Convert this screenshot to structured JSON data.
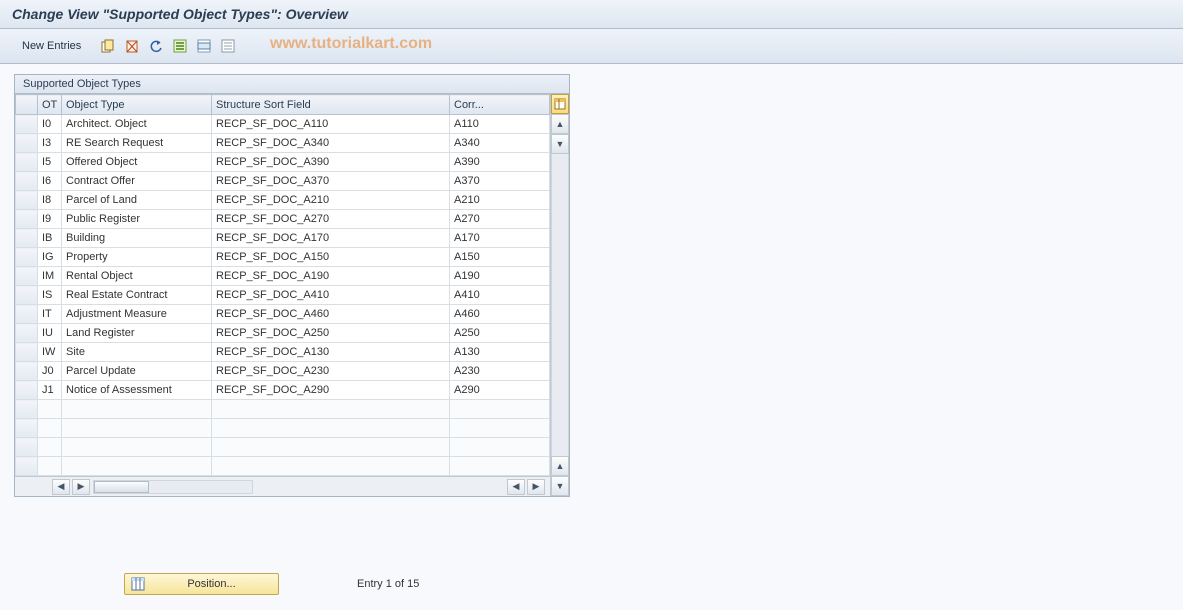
{
  "title": "Change View \"Supported Object Types\": Overview",
  "toolbar": {
    "new_entries": "New Entries"
  },
  "watermark": "www.tutorialkart.com",
  "panel": {
    "title": "Supported Object Types"
  },
  "columns": {
    "ot": "OT",
    "object_type": "Object Type",
    "structure": "Structure Sort Field",
    "corr": "Corr..."
  },
  "rows": [
    {
      "ot": "I0",
      "type": "Architect. Object",
      "struct": "RECP_SF_DOC_A110",
      "corr": "A110"
    },
    {
      "ot": "I3",
      "type": "RE Search Request",
      "struct": "RECP_SF_DOC_A340",
      "corr": "A340"
    },
    {
      "ot": "I5",
      "type": "Offered Object",
      "struct": "RECP_SF_DOC_A390",
      "corr": "A390"
    },
    {
      "ot": "I6",
      "type": "Contract Offer",
      "struct": "RECP_SF_DOC_A370",
      "corr": "A370"
    },
    {
      "ot": "I8",
      "type": "Parcel of Land",
      "struct": "RECP_SF_DOC_A210",
      "corr": "A210"
    },
    {
      "ot": "I9",
      "type": "Public Register",
      "struct": "RECP_SF_DOC_A270",
      "corr": "A270"
    },
    {
      "ot": "IB",
      "type": "Building",
      "struct": "RECP_SF_DOC_A170",
      "corr": "A170"
    },
    {
      "ot": "IG",
      "type": "Property",
      "struct": "RECP_SF_DOC_A150",
      "corr": "A150"
    },
    {
      "ot": "IM",
      "type": "Rental Object",
      "struct": "RECP_SF_DOC_A190",
      "corr": "A190"
    },
    {
      "ot": "IS",
      "type": "Real Estate Contract",
      "struct": "RECP_SF_DOC_A410",
      "corr": "A410"
    },
    {
      "ot": "IT",
      "type": "Adjustment Measure",
      "struct": "RECP_SF_DOC_A460",
      "corr": "A460"
    },
    {
      "ot": "IU",
      "type": "Land Register",
      "struct": "RECP_SF_DOC_A250",
      "corr": "A250"
    },
    {
      "ot": "IW",
      "type": "Site",
      "struct": "RECP_SF_DOC_A130",
      "corr": "A130"
    },
    {
      "ot": "J0",
      "type": "Parcel Update",
      "struct": "RECP_SF_DOC_A230",
      "corr": "A230"
    },
    {
      "ot": "J1",
      "type": "Notice of Assessment",
      "struct": "RECP_SF_DOC_A290",
      "corr": "A290"
    }
  ],
  "footer": {
    "position_label": "Position...",
    "entry_text": "Entry 1 of 15"
  }
}
